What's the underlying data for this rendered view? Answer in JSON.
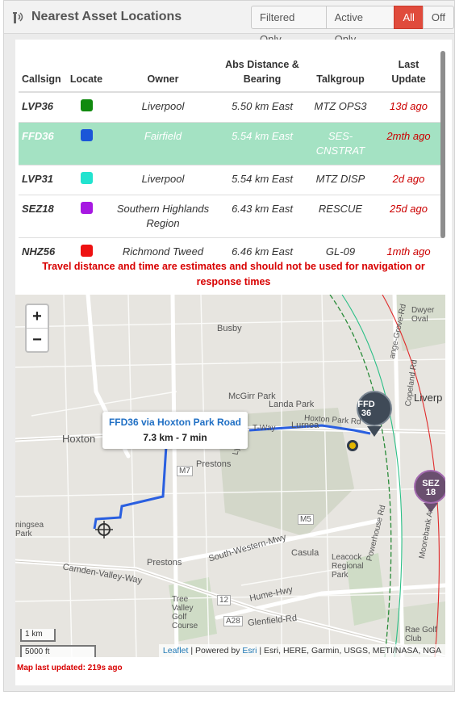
{
  "header": {
    "title": "Nearest Asset Locations",
    "filters": [
      {
        "label": "Filtered Only",
        "active": false
      },
      {
        "label": "Active Only",
        "active": false
      },
      {
        "label": "All",
        "active": true
      },
      {
        "label": "Off",
        "active": false
      }
    ]
  },
  "table": {
    "columns": {
      "callsign": "Callsign",
      "locate": "Locate",
      "owner": "Owner",
      "distance_line1": "Abs Distance &",
      "distance_line2": "Bearing",
      "talkgroup": "Talkgroup",
      "updated_line1": "Last",
      "updated_line2": "Update"
    },
    "rows": [
      {
        "callsign": "LVP36",
        "color": "#118a0f",
        "owner": "Liverpool",
        "distance": "5.50 km East",
        "talkgroup": "MTZ OPS3",
        "updated": "13d ago"
      },
      {
        "callsign": "FFD36",
        "color": "#1b56d8",
        "owner": "Fairfield",
        "distance": "5.54 km East",
        "talkgroup": "SES-CNSTRAT",
        "updated": "2mth ago",
        "selected": true
      },
      {
        "callsign": "LVP31",
        "color": "#22e3cf",
        "owner": "Liverpool",
        "distance": "5.54 km East",
        "talkgroup": "MTZ DISP",
        "updated": "2d ago"
      },
      {
        "callsign": "SEZ18",
        "color": "#a718e2",
        "owner": "Southern Highlands Region",
        "distance": "6.43 km East",
        "talkgroup": "RESCUE",
        "updated": "25d ago"
      },
      {
        "callsign": "NHZ56",
        "color": "#ee1111",
        "owner": "Richmond Tweed",
        "distance": "6.46 km East",
        "talkgroup": "GL-09",
        "updated": "1mth ago"
      }
    ]
  },
  "warning": "Travel distance and time are estimates and should not be used for navigation or response times",
  "map": {
    "zoom_in": "+",
    "zoom_out": "−",
    "popup_title": "FFD36 via Hoxton Park Road",
    "popup_detail": "7.3 km - 7 min",
    "markers": [
      {
        "line1": "FFD",
        "line2": "36"
      },
      {
        "line1": "SEZ",
        "line2": "18"
      }
    ],
    "labels": {
      "busby": "Busby",
      "mcgirr_park": "McGirr Park",
      "landa_park": "Landa Park",
      "hoxton": "Hoxton",
      "lurnea": "Lurnea",
      "prestons_north": "Prestons",
      "prestons_south": "Prestons",
      "casula": "Casula",
      "liverpool": "Liverp",
      "dwyer_oval": "Dwyer Oval",
      "leacock": "Leacock Regional Park",
      "tree_valley": "Tree Valley Golf Course",
      "rae_golf": "Rae Golf Club",
      "hoxton_park_rd": "Hoxton Park Rd",
      "t_way": "T-Way",
      "lyn_pde": "Lyn Pde",
      "m7": "M7",
      "m5": "M5",
      "a28": "A28",
      "route_12": "12",
      "south_western_mwy": "South-Western-Mwy",
      "hume_hwy": "Hume-Hwy",
      "camden_valley_way": "Camden-Valley-Way",
      "glenfield_rd": "Glenfield-Rd",
      "copeland_rd": "Copeland Rd",
      "powerhouse_rd": "Powerhouse Rd",
      "moorebank_av": "Moorebank Av",
      "grange_grove_rd": "ange-Grove-Rd",
      "kingsea_park": "ningsea Park"
    },
    "scale_km": "1 km",
    "scale_ft": "5000 ft",
    "attribution": {
      "leaflet": "Leaflet",
      "powered": "| Powered by",
      "esri": "Esri",
      "rest": "| Esri, HERE, Garmin, USGS, METI/NASA, NGA"
    }
  },
  "map_updated": "Map last updated: 219s ago"
}
